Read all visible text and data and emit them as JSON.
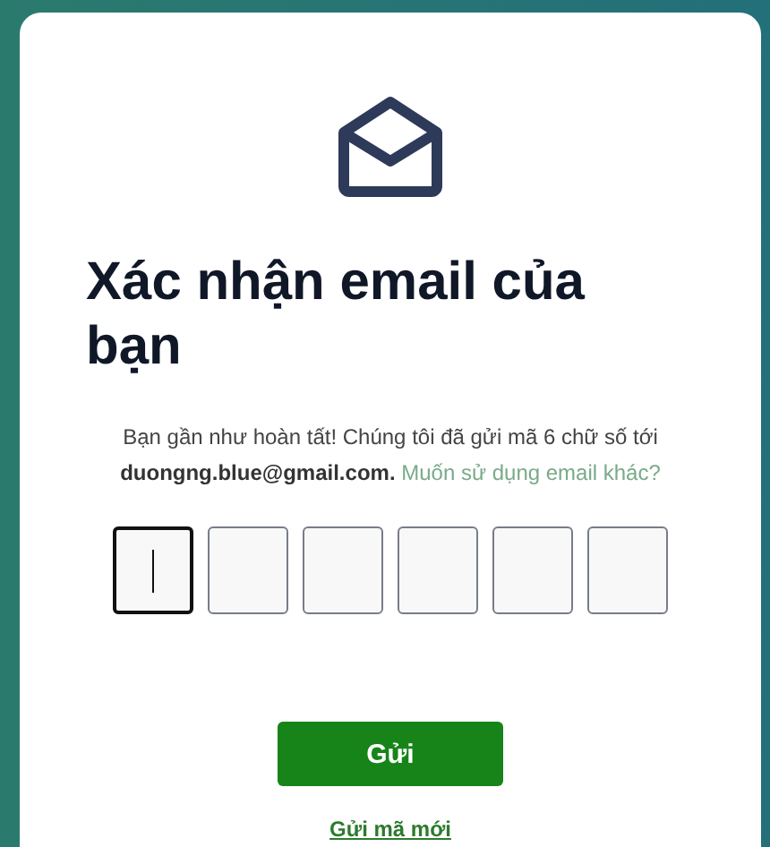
{
  "title": "Xác nhận email của bạn",
  "message": {
    "text": "Bạn gần như hoàn tất! Chúng tôi đã gửi mã 6 chữ số tới **duongng.blue@gmail.com.**",
    "link": "Muốn sử dụng email khác?"
  },
  "code_boxes": [
    {
      "focused": true
    },
    {
      "focused": false
    },
    {
      "focused": false
    },
    {
      "focused": false
    },
    {
      "focused": false
    },
    {
      "focused": false
    }
  ],
  "submit_button": "Gửi",
  "resend_link": "Gửi mã mới"
}
